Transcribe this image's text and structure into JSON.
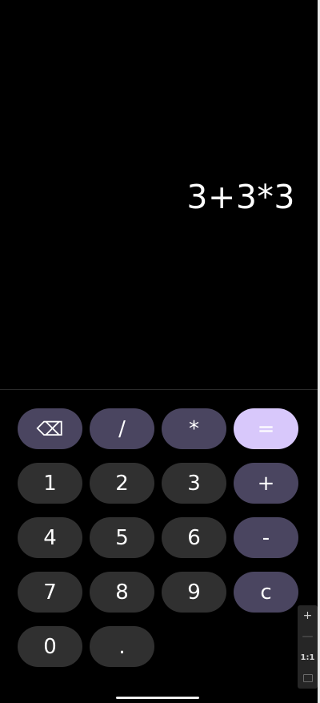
{
  "display": {
    "expression": "3+3*3"
  },
  "keys": {
    "backspace_icon": "backspace-icon",
    "backspace_glyph": "⌫",
    "divide": "/",
    "multiply": "*",
    "equals": "=",
    "one": "1",
    "two": "2",
    "three": "3",
    "plus": "+",
    "four": "4",
    "five": "5",
    "six": "6",
    "minus": "-",
    "seven": "7",
    "eight": "8",
    "nine": "9",
    "clear": "c",
    "zero": "0",
    "decimal": "."
  },
  "zoom_controls": {
    "zoom_in": "+",
    "zoom_out": "—",
    "actual_size": "1:1"
  },
  "colors": {
    "background": "#000000",
    "number_key": "#303030",
    "operator_key": "#4a4560",
    "equals_key": "#d8c8fb",
    "text": "#ffffff"
  }
}
